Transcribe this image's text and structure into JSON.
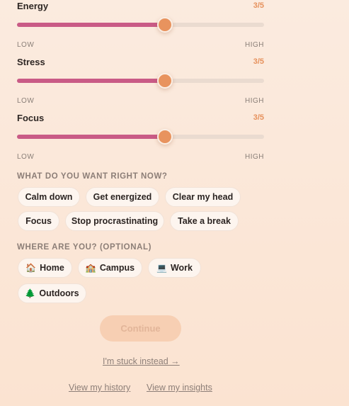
{
  "sliders": [
    {
      "label": "Energy",
      "value_text": "3/5",
      "value": 3,
      "max": 5,
      "low": "LOW",
      "high": "HIGH"
    },
    {
      "label": "Stress",
      "value_text": "3/5",
      "value": 3,
      "max": 5,
      "low": "LOW",
      "high": "HIGH"
    },
    {
      "label": "Focus",
      "value_text": "3/5",
      "value": 3,
      "max": 5,
      "low": "LOW",
      "high": "HIGH"
    }
  ],
  "want": {
    "title": "WHAT DO YOU WANT RIGHT NOW?",
    "options": [
      "Calm down",
      "Get energized",
      "Clear my head",
      "Focus",
      "Stop procrastinating",
      "Take a break"
    ]
  },
  "where": {
    "title": "WHERE ARE YOU? (OPTIONAL)",
    "options": [
      {
        "emoji": "🏠",
        "label": "Home"
      },
      {
        "emoji": "🏫",
        "label": "Campus"
      },
      {
        "emoji": "💻",
        "label": "Work"
      },
      {
        "emoji": "🌲",
        "label": "Outdoors"
      }
    ]
  },
  "actions": {
    "continue": "Continue",
    "stuck": "I'm stuck instead →",
    "history": "View my history",
    "insights": "View my insights"
  },
  "colors": {
    "accent": "#e8935e",
    "fill": "#c95b86",
    "track": "#eadbd0"
  }
}
